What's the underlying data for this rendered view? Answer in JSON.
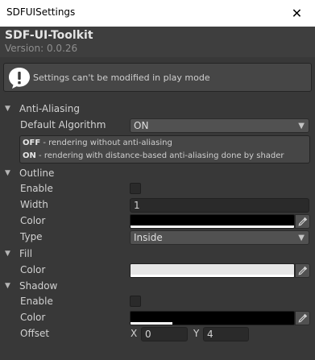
{
  "window": {
    "title": "SDFUISettings",
    "close_glyph": "✕"
  },
  "header": {
    "name": "SDF-UI-Toolkit",
    "version": "Version: 0.0.26"
  },
  "helpbox": {
    "message": "Settings can't be modified in play mode",
    "icon": "info-icon"
  },
  "anti_aliasing": {
    "label": "Anti-Aliasing",
    "default_algorithm": {
      "label": "Default Algorithm",
      "value": "ON"
    },
    "descriptions": [
      {
        "key": "OFF",
        "text": " - rendering without anti-aliasing"
      },
      {
        "key": "ON",
        "text": " - rendering with distance-based anti-aliasing done by shader"
      }
    ]
  },
  "outline": {
    "label": "Outline",
    "enable": {
      "label": "Enable",
      "checked": false
    },
    "width": {
      "label": "Width",
      "value": "1"
    },
    "color": {
      "label": "Color",
      "hex": "#000000",
      "alpha": 1.0
    },
    "type": {
      "label": "Type",
      "value": "Inside"
    }
  },
  "fill": {
    "label": "Fill",
    "color": {
      "label": "Color",
      "hex": "#e6e6e6",
      "alpha": 1.0
    }
  },
  "shadow": {
    "label": "Shadow",
    "enable": {
      "label": "Enable",
      "checked": false
    },
    "color": {
      "label": "Color",
      "hex": "#000000",
      "alpha": 0.25
    },
    "offset": {
      "label": "Offset",
      "x_label": "X",
      "x": "0",
      "y_label": "Y",
      "y": "4"
    }
  },
  "colors": {
    "background": "#383838",
    "field_dark": "#2a2a2a",
    "dropdown": "#515151"
  }
}
